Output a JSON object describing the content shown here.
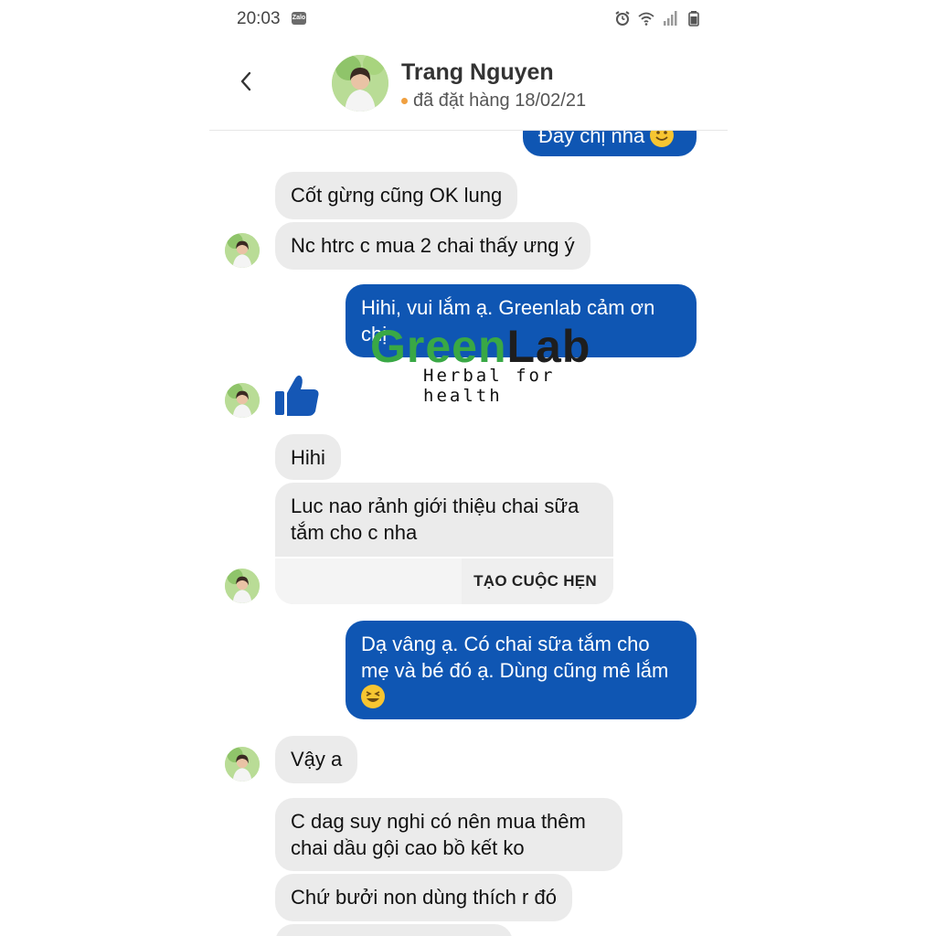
{
  "status_bar": {
    "time": "20:03",
    "app_badge": "Zalo"
  },
  "header": {
    "contact_name": "Trang Nguyen",
    "contact_status": "đã đặt hàng 18/02/21"
  },
  "messages": {
    "m0": "Đây chị nha",
    "m1": "Cốt gừng cũng OK lung",
    "m2": "Nc htrc c mua 2 chai thấy ưng ý",
    "m3": "Hihi, vui lắm ạ. Greenlab cảm ơn chị",
    "m4": "Hihi",
    "m5_card": "Luc nao rảnh giới thiệu chai sữa tắm cho c nha",
    "m5_action": "TẠO CUỘC HẸN",
    "m6": "Dạ vâng ạ. Có chai sữa tắm cho mẹ và bé đó ạ. Dùng cũng mê lắm",
    "m7": "Vậy a",
    "m8": "C dag suy nghi có nên mua thêm chai dầu gội cao bồ kết ko",
    "m9": "Chứ bưởi non dùng thích r đó"
  },
  "logo": {
    "word_green": "Green",
    "word_dark": "Lab",
    "tagline": "Herbal for health"
  },
  "colors": {
    "outgoing_bubble": "#0f56b3",
    "incoming_bubble": "#ebebeb",
    "logo_green": "#39a845",
    "status_dot": "#f0a040"
  }
}
